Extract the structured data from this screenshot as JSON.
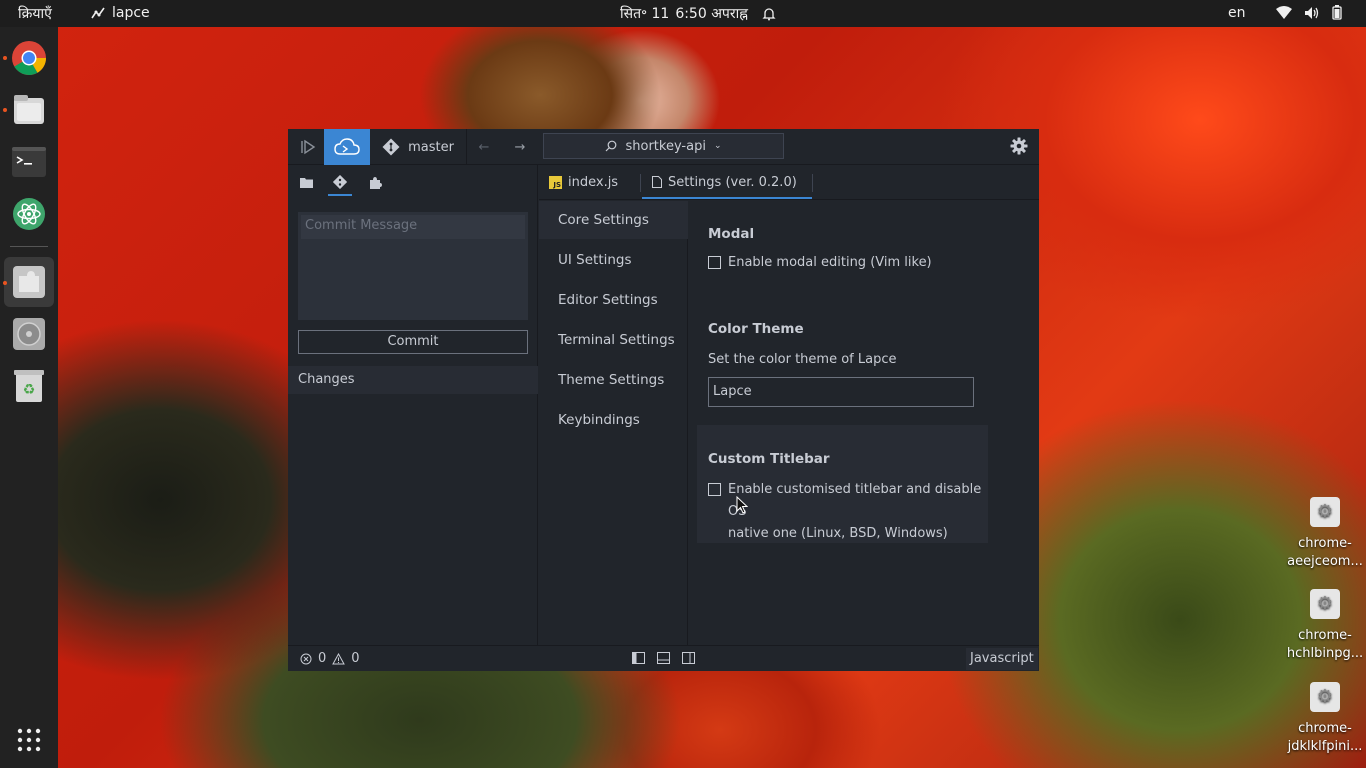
{
  "topbar": {
    "activities": "क्रियाएँ",
    "app_name": "lapce",
    "date": "सित॰ 11",
    "time": "6:50 अपराह्न",
    "language": "en"
  },
  "dock": {
    "apps": [
      "chrome-icon",
      "files-icon",
      "terminal-icon",
      "atom-icon",
      "extension-icon",
      "disc-icon",
      "trash-icon"
    ],
    "show_apps": "grid-icon"
  },
  "desktop_icons": [
    {
      "label_line1": "chrome-",
      "label_line2": "aeejceom..."
    },
    {
      "label_line1": "chrome-",
      "label_line2": "hchlbinpg..."
    },
    {
      "label_line1": "chrome-",
      "label_line2": "jdklklfpini..."
    }
  ],
  "window": {
    "branch": "master",
    "workspace": "shortkey-api",
    "accent": "#3b86d3",
    "left_panel": {
      "commit_placeholder": "Commit Message",
      "commit_button": "Commit",
      "changes_label": "Changes"
    },
    "tabs": [
      {
        "label": "index.js"
      },
      {
        "label": "Settings (ver. 0.2.0)"
      }
    ],
    "settings_nav": [
      "Core Settings",
      "UI Settings",
      "Editor Settings",
      "Terminal Settings",
      "Theme Settings",
      "Keybindings"
    ],
    "settings": {
      "modal": {
        "title": "Modal",
        "checkbox_label": "Enable modal editing (Vim like)"
      },
      "color_theme": {
        "title": "Color Theme",
        "description": "Set the color theme of Lapce",
        "value": "Lapce"
      },
      "custom_titlebar": {
        "title": "Custom Titlebar",
        "checkbox_label_line1": "Enable customised titlebar and disable OS",
        "checkbox_label_line2": "native one (Linux, BSD, Windows)"
      }
    },
    "status": {
      "errors": "0",
      "warnings": "0",
      "language": "Javascript"
    }
  }
}
